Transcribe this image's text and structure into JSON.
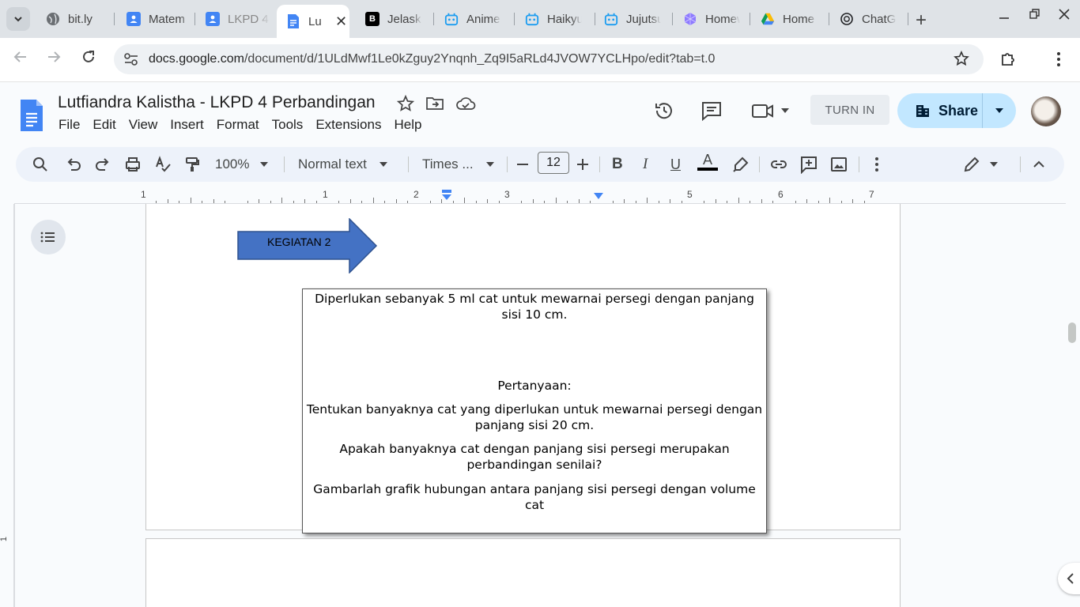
{
  "browser": {
    "tabs": [
      {
        "title": "bit.ly",
        "icon": "globe-icon",
        "color": "#5f6368"
      },
      {
        "title": "Matem",
        "icon": "classroom-icon",
        "color": "#4285f4"
      },
      {
        "title": "LKPD 4",
        "icon": "classroom-icon",
        "color": "#4285f4"
      },
      {
        "title": "Lu",
        "icon": "docs-icon",
        "color": "#4285f4",
        "active": true
      },
      {
        "title": "Jelask",
        "icon": "brainly-icon",
        "color": "#000000"
      },
      {
        "title": "Anime",
        "icon": "bot-icon",
        "color": "#1a9cf0"
      },
      {
        "title": "Haikyu",
        "icon": "bot-icon",
        "color": "#1a9cf0"
      },
      {
        "title": "Jujutsu",
        "icon": "bot-icon",
        "color": "#1a9cf0"
      },
      {
        "title": "Homew",
        "icon": "gem-icon",
        "color": "#7b61ff"
      },
      {
        "title": "Home",
        "icon": "drive-icon",
        "color": "#0f9d58"
      },
      {
        "title": "ChatG",
        "icon": "openai-icon",
        "color": "#202124"
      }
    ],
    "url_host": "docs.google.com",
    "url_path": "/document/d/1ULdMwf1Le0kZguy2Ynqnh_Zq9I5aRLd4JVOW7YCLHpo/edit?tab=t.0"
  },
  "doc": {
    "title": "Lutfiandra Kalistha - LKPD 4 Perbandingan",
    "menu": [
      "File",
      "Edit",
      "View",
      "Insert",
      "Format",
      "Tools",
      "Extensions",
      "Help"
    ],
    "turn_in": "TURN IN",
    "share": "Share"
  },
  "format_toolbar": {
    "zoom": "100%",
    "style": "Normal text",
    "font": "Times ...",
    "font_size": "12",
    "text_color": "#000000",
    "text_color_letter": "A"
  },
  "ruler": {
    "numbers": [
      "1",
      "1",
      "2",
      "3",
      "5",
      "6",
      "7"
    ]
  },
  "vruler": {
    "label": "1"
  },
  "content": {
    "arrow_label": "KEGIATAN 2",
    "textbox_lines": [
      "Diperlukan sebanyak 5 ml  cat untuk mewarnai persegi dengan panjang sisi 10 cm.",
      "Pertanyaan:",
      "Tentukan banyaknya cat yang diperlukan untuk mewarnai persegi dengan panjang sisi 20 cm.",
      "Apakah banyaknya cat dengan panjang sisi persegi merupakan perbandingan senilai?",
      "Gambarlah grafik hubungan antara panjang sisi persegi dengan volume cat"
    ]
  }
}
